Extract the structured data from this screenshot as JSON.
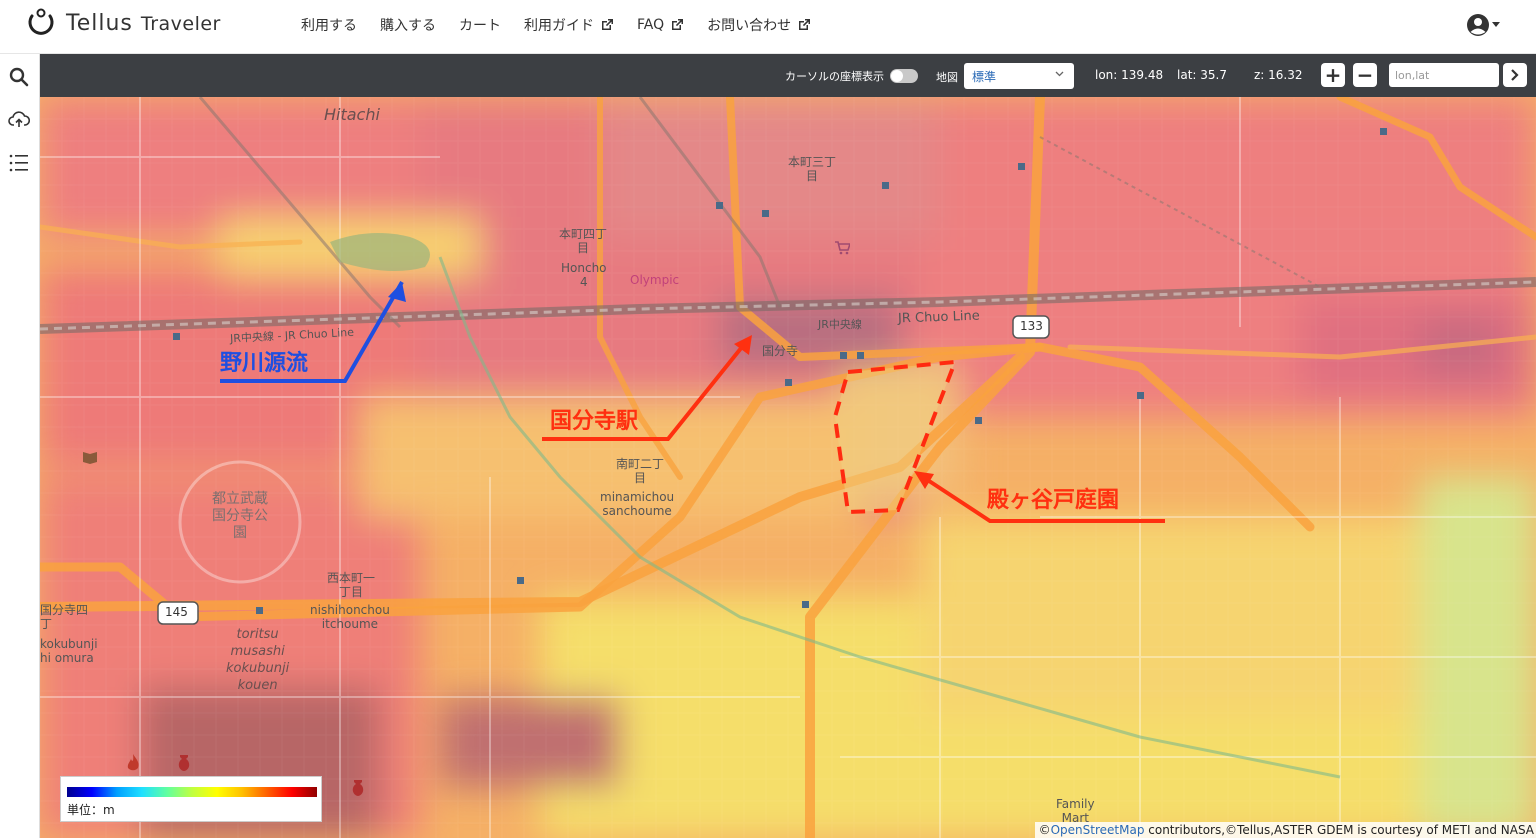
{
  "app": {
    "name": "Tellus",
    "sub": "Traveler"
  },
  "nav": {
    "items": [
      {
        "label": "利用する",
        "external": false
      },
      {
        "label": "購入する",
        "external": false
      },
      {
        "label": "カート",
        "external": false
      },
      {
        "label": "利用ガイド",
        "external": true
      },
      {
        "label": "FAQ",
        "external": true
      },
      {
        "label": "お問い合わせ",
        "external": true
      }
    ]
  },
  "sidebar": {
    "icons": [
      "search-icon",
      "cloud-upload-icon",
      "list-icon"
    ]
  },
  "toolbar": {
    "cursor_coords_label": "カーソルの座標表示",
    "cursor_coords_enabled": false,
    "map_label": "地図",
    "map_select_value": "標準",
    "lon_label": "lon: 139.48",
    "lat_label": "lat: 35.7",
    "zoom_label": "z: 16.32",
    "zoom_in": "+",
    "zoom_out": "−",
    "search_placeholder": "lon,lat",
    "go_icon": "chevron-right-icon"
  },
  "map": {
    "labels": {
      "hitachi": "Hitachi",
      "honmachi3": "本町三丁\n目",
      "honmachi4": "本町四丁\n目",
      "honcho4": "Honcho\n4",
      "olympic": "Olympic",
      "jr_chuo_left": "JR中央線 - JR Chuo Line",
      "jr_chuo_right": "JR Chuo Line",
      "jr_chuo_jp": "JR中央線",
      "station_jp": "国分寺",
      "route133": "133",
      "route145": "145",
      "minami2_jp": "南町二丁\n目",
      "minami": "minamichou\nsanchoume",
      "park_jp": "都立武蔵\n国分寺公\n園",
      "nishihon_jp": "西本町一\n丁目",
      "nishihon": "nishihonchou\nitchoume",
      "kokubunji4_jp": "国分寺四\n丁",
      "kokubunji_omura": "kokubunji\nhi omura",
      "toritsu": "toritsu\nmusashi\nkokubunji\nkouen",
      "family": "Family\nMart"
    },
    "annotations": {
      "nogawa": "野川源流",
      "station": "国分寺駅",
      "garden": "殿ヶ谷戸庭園"
    },
    "annotation_colors": {
      "blue": "#1f4fe0",
      "red": "#ff3010"
    }
  },
  "legend": {
    "unit": "単位：m"
  },
  "attribution": {
    "prefix": "©",
    "osm": "OpenStreetMap",
    "rest": " contributors,©Tellus,ASTER GDEM is courtesy of METI and NASA"
  }
}
